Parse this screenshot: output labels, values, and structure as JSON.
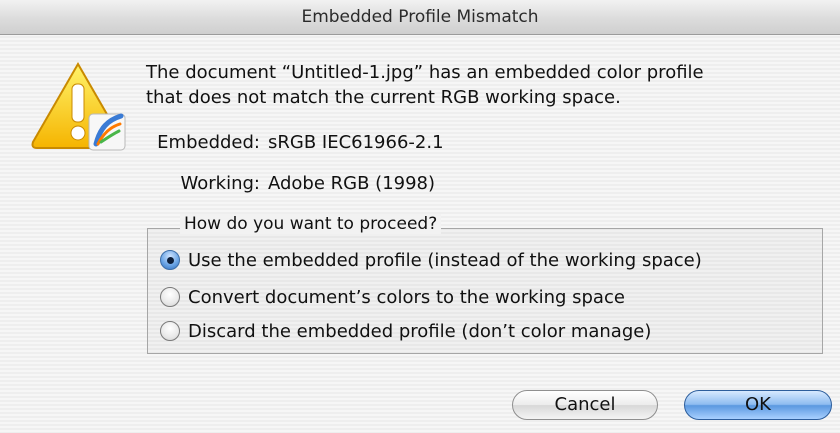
{
  "window": {
    "title": "Embedded Profile Mismatch"
  },
  "icons": {
    "warning": "warning-triangle-with-app-badge-icon"
  },
  "message": {
    "line1": "The document “Untitled-1.jpg” has an embedded color profile",
    "line2": "that does not match the current RGB working space."
  },
  "profiles": {
    "embedded": {
      "label": "Embedded:",
      "value": "sRGB IEC61966-2.1"
    },
    "working": {
      "label": "Working:",
      "value": "Adobe RGB (1998)"
    }
  },
  "options": {
    "legend": "How do you want to proceed?",
    "items": [
      {
        "label": "Use the embedded profile (instead of the working space)",
        "selected": true
      },
      {
        "label": "Convert document’s colors to the working space",
        "selected": false
      },
      {
        "label": "Discard the embedded profile (don’t color manage)",
        "selected": false
      }
    ]
  },
  "buttons": {
    "cancel": "Cancel",
    "ok": "OK"
  },
  "colors": {
    "default_button": "#5a98e0",
    "warning_yellow": "#ffd21e"
  }
}
